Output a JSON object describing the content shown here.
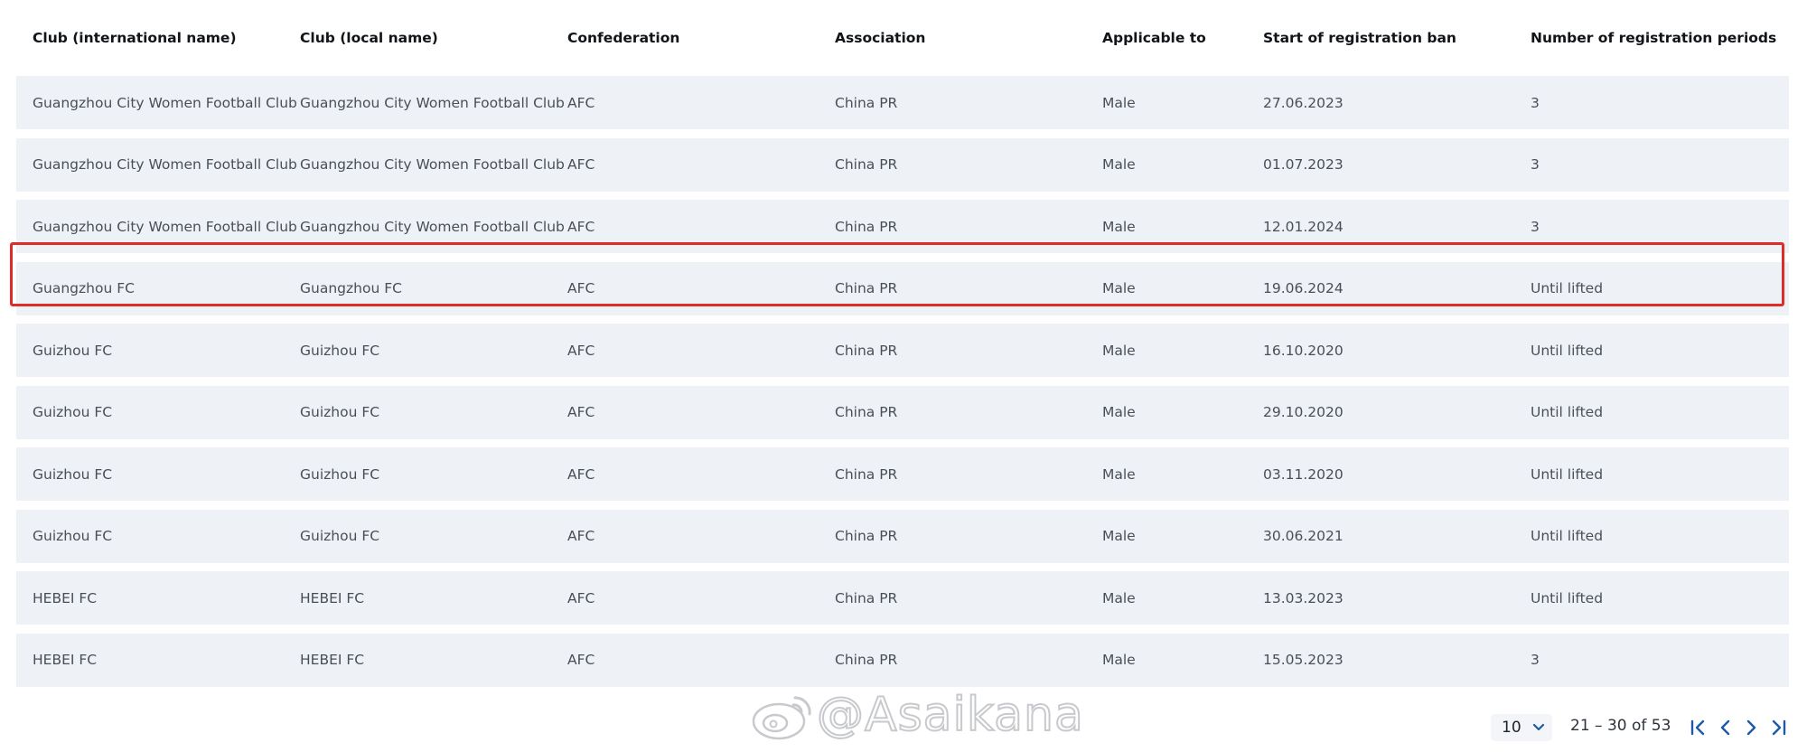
{
  "table": {
    "headers": [
      "Club (international name)",
      "Club (local name)",
      "Confederation",
      "Association",
      "Applicable to",
      "Start of registration ban",
      "Number of registration periods"
    ],
    "rows": [
      [
        "Guangzhou City Women Football Club",
        "Guangzhou City Women Football Club",
        "AFC",
        "China PR",
        "Male",
        "27.06.2023",
        "3"
      ],
      [
        "Guangzhou City Women Football Club",
        "Guangzhou City Women Football Club",
        "AFC",
        "China PR",
        "Male",
        "01.07.2023",
        "3"
      ],
      [
        "Guangzhou City Women Football Club",
        "Guangzhou City Women Football Club",
        "AFC",
        "China PR",
        "Male",
        "12.01.2024",
        "3"
      ],
      [
        "Guangzhou FC",
        "Guangzhou FC",
        "AFC",
        "China PR",
        "Male",
        "19.06.2024",
        "Until lifted"
      ],
      [
        "Guizhou FC",
        "Guizhou FC",
        "AFC",
        "China PR",
        "Male",
        "16.10.2020",
        "Until lifted"
      ],
      [
        "Guizhou FC",
        "Guizhou FC",
        "AFC",
        "China PR",
        "Male",
        "29.10.2020",
        "Until lifted"
      ],
      [
        "Guizhou FC",
        "Guizhou FC",
        "AFC",
        "China PR",
        "Male",
        "03.11.2020",
        "Until lifted"
      ],
      [
        "Guizhou FC",
        "Guizhou FC",
        "AFC",
        "China PR",
        "Male",
        "30.06.2021",
        "Until lifted"
      ],
      [
        "HEBEI FC",
        "HEBEI FC",
        "AFC",
        "China PR",
        "Male",
        "13.03.2023",
        "Until lifted"
      ],
      [
        "HEBEI FC",
        "HEBEI FC",
        "AFC",
        "China PR",
        "Male",
        "15.05.2023",
        "3"
      ]
    ],
    "highlighted_row_index": 3
  },
  "pagination": {
    "page_size": "10",
    "range_text": "21 – 30 of 53",
    "icons": {
      "first": "first-page-icon",
      "prev": "chevron-left-icon",
      "next": "chevron-right-icon",
      "last": "last-page-icon"
    },
    "icon_color": "#1e5aa8"
  },
  "watermark": {
    "text": "@Asaikana",
    "icon": "weibo-logo-icon"
  },
  "colors": {
    "row_background": "#eef1f6",
    "highlight_border": "#e02b2b"
  }
}
